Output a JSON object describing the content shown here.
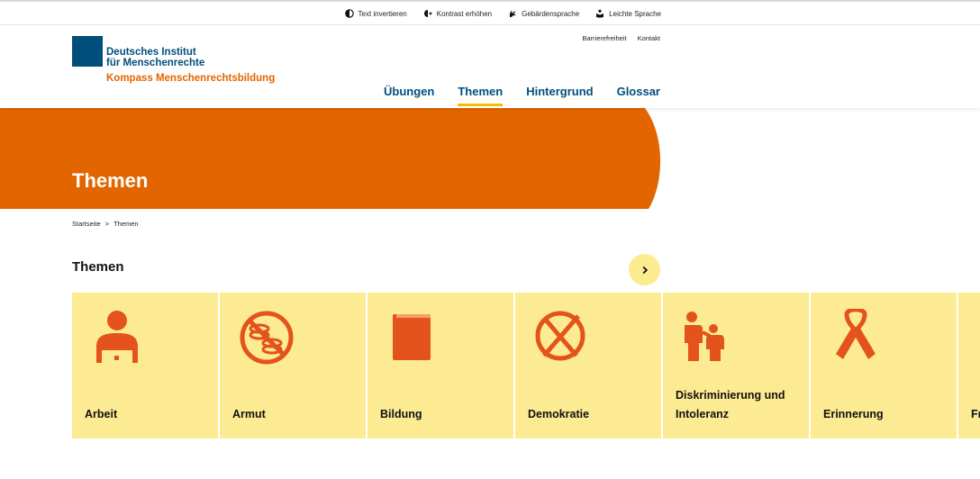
{
  "a11y_bar": {
    "items": [
      {
        "label": "Text invertieren",
        "icon": "contrast-half-icon"
      },
      {
        "label": "Kontrast erhöhen",
        "icon": "contrast-plus-icon"
      },
      {
        "label": "Gebärdensprache",
        "icon": "sign-language-icon"
      },
      {
        "label": "Leichte Sprache",
        "icon": "easy-language-icon"
      }
    ]
  },
  "header": {
    "logo": {
      "line1": "Deutsches Institut",
      "line2": "für Menschenrechte",
      "line3": "Kompass Menschenrechtsbildung"
    },
    "service_links": [
      "Barrierefreiheit",
      "Kontakt"
    ],
    "nav": [
      {
        "label": "Übungen",
        "active": false
      },
      {
        "label": "Themen",
        "active": true
      },
      {
        "label": "Hintergrund",
        "active": false
      },
      {
        "label": "Glossar",
        "active": false
      }
    ]
  },
  "hero": {
    "title": "Themen"
  },
  "breadcrumb": {
    "home": "Startseite",
    "separator": ">",
    "current": "Themen"
  },
  "section": {
    "title": "Themen",
    "cards": [
      {
        "label": "Arbeit",
        "icon": "worker-icon"
      },
      {
        "label": "Armut",
        "icon": "no-money-icon"
      },
      {
        "label": "Bildung",
        "icon": "book-icon"
      },
      {
        "label": "Demokratie",
        "icon": "ballot-cross-icon"
      },
      {
        "label": "Diskriminierung und Intoleranz",
        "icon": "people-icon"
      },
      {
        "label": "Erinnerung",
        "icon": "ribbon-icon"
      },
      {
        "label": "Fr",
        "icon": ""
      }
    ]
  },
  "colors": {
    "brand_blue": "#004e7c",
    "brand_orange": "#e36500",
    "card_yellow": "#fdeb93",
    "nav_underline": "#f2bf00"
  }
}
